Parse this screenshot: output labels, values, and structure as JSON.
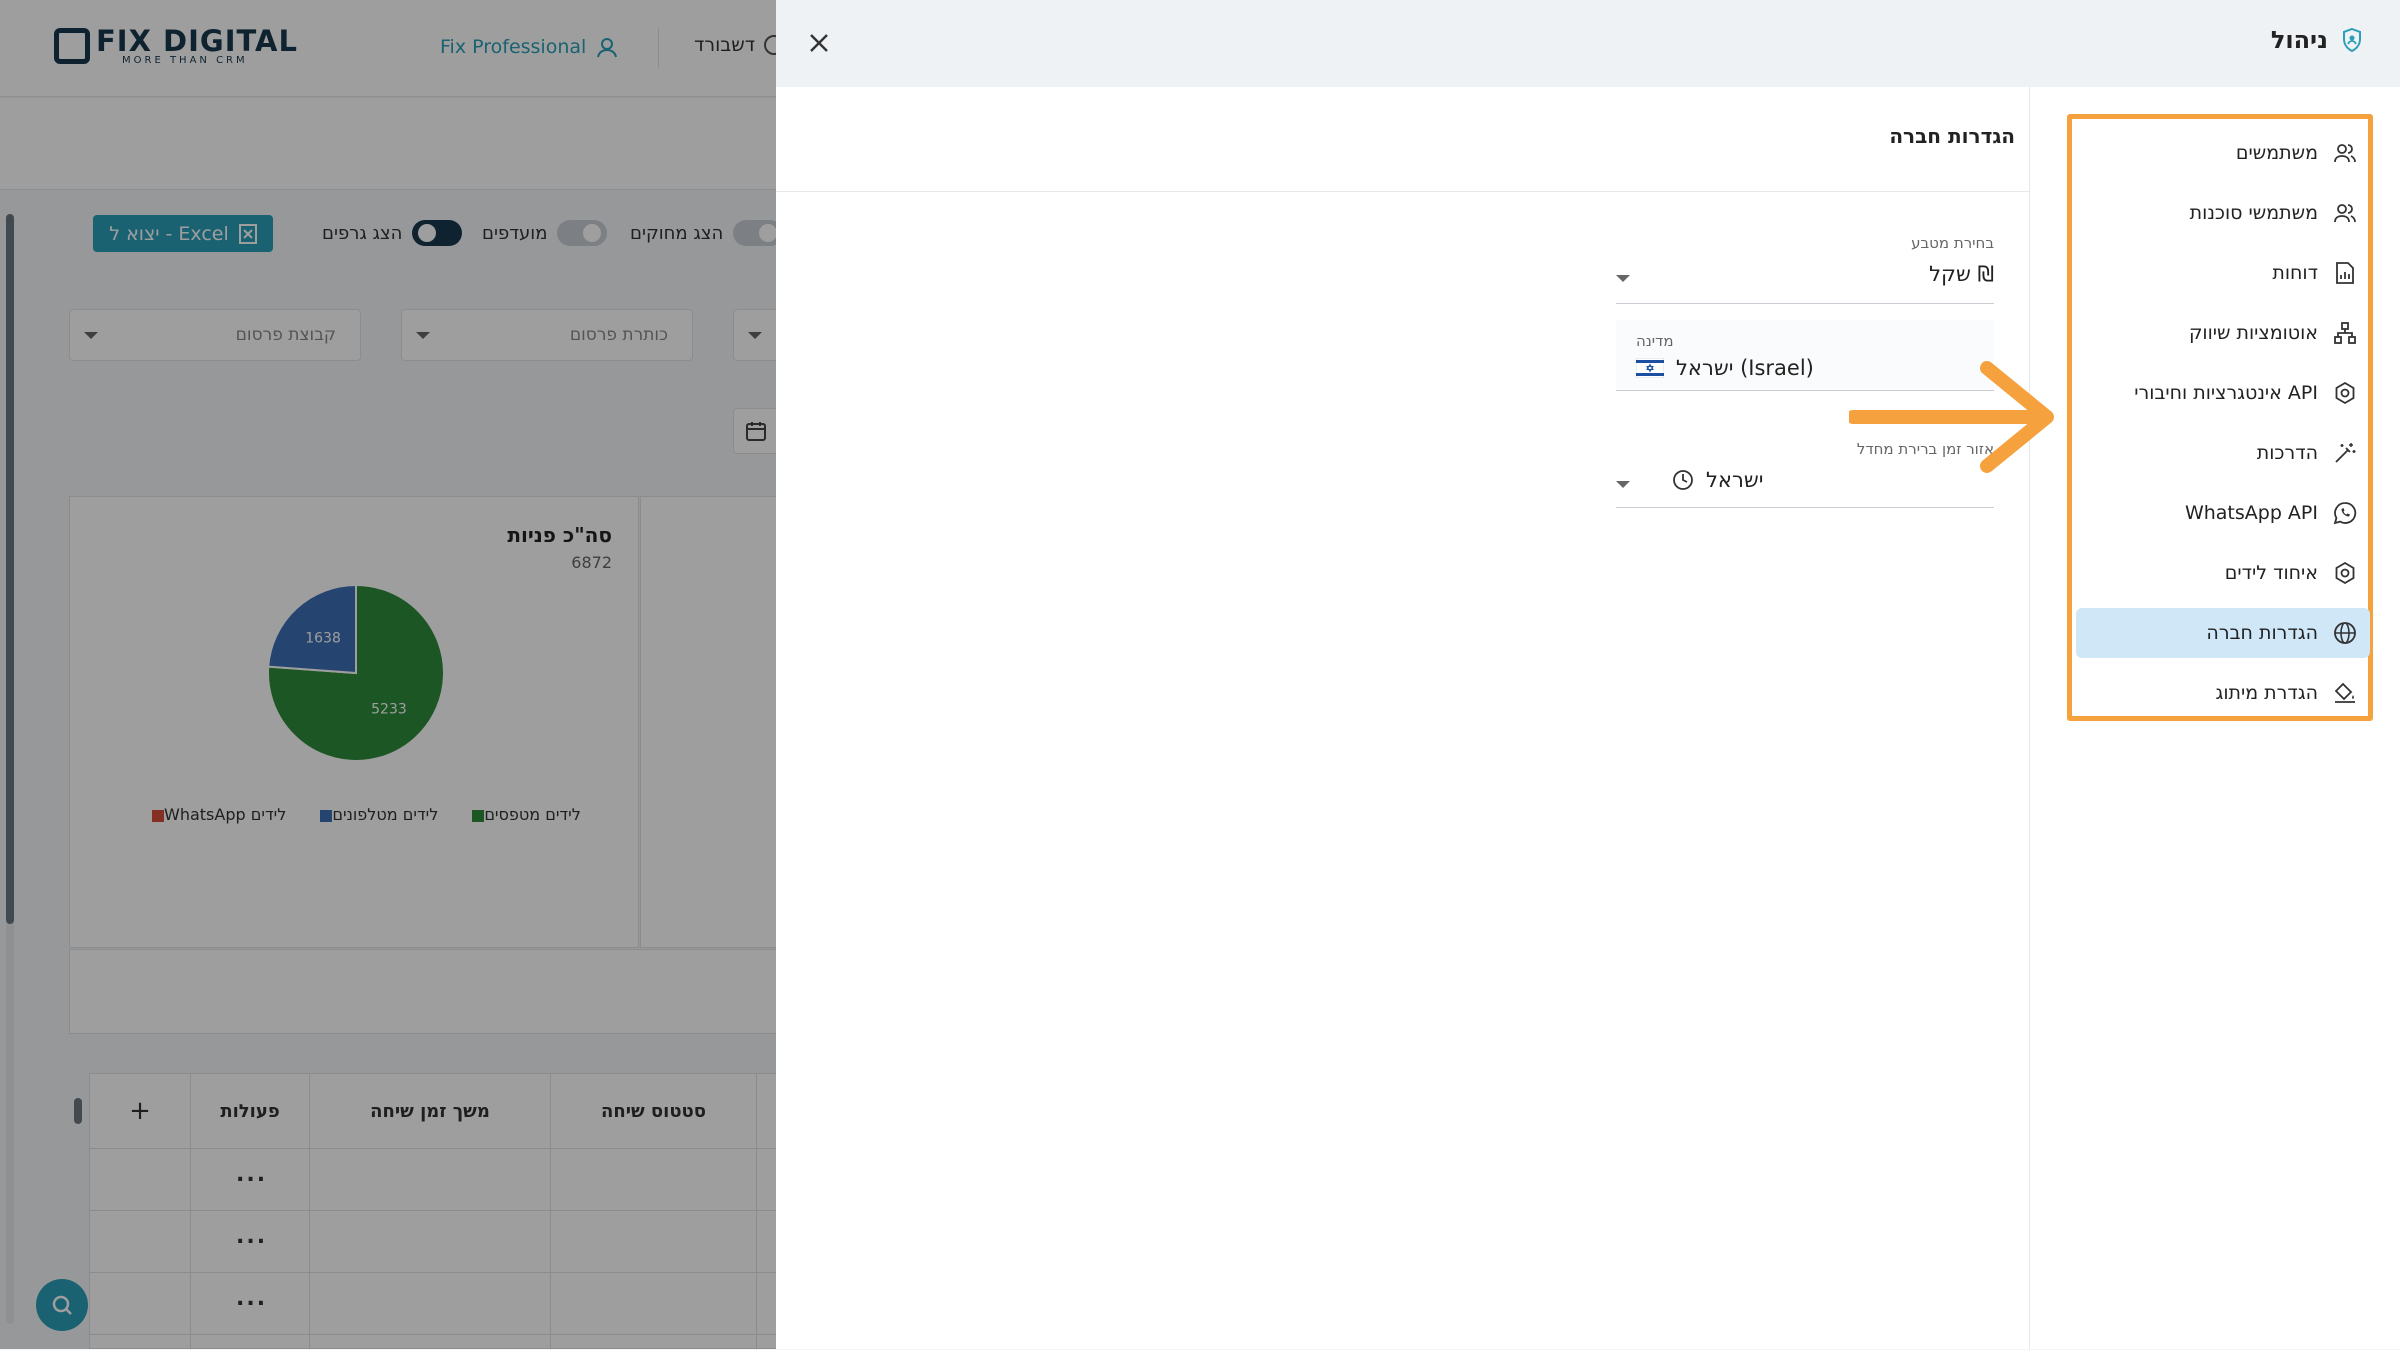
{
  "background": {
    "logo": {
      "main": "FIX DIGITAL",
      "sub": "MORE THAN CRM"
    },
    "top_links": {
      "professional": "Fix Professional",
      "dashboard": "דשבורד"
    },
    "export_button": "יצוא ל - Excel",
    "toggles": [
      {
        "label": "הצג גרפים",
        "on": true
      },
      {
        "label": "מועדפים",
        "on": false
      },
      {
        "label": "הצג מחוקים",
        "on": false
      }
    ],
    "filters": {
      "campaign_group": "קבוצת פרסום",
      "campaign_title": "כותרת פרסום"
    },
    "card": {
      "title": "סה\"כ פניות",
      "total": "6872",
      "legend": [
        "לידים מטפסים",
        "לידים מטלפונים",
        "WhatsApp לידים"
      ],
      "legend_colors": [
        "#2e8b3a",
        "#3c6fb4",
        "#d64b3a"
      ]
    },
    "table": {
      "headers": {
        "status": "סטטוס שיחה",
        "duration": "משך זמן שיחה",
        "actions": "פעולות",
        "add": "+"
      },
      "row_action": "..."
    }
  },
  "chart_data": {
    "type": "pie",
    "title": "סה\"כ פניות",
    "total": 6872,
    "categories": [
      "לידים מטפסים",
      "לידים מטלפונים",
      "WhatsApp לידים"
    ],
    "values": [
      5233,
      1638,
      0
    ],
    "labels": [
      "5233",
      "1638",
      ""
    ],
    "colors": [
      "#2e8b3a",
      "#3c6fb4",
      "#d64b3a"
    ]
  },
  "drawer": {
    "title": "ניהול",
    "close_label": "×",
    "nav_items": [
      {
        "label": "משתמשים",
        "icon": "users-icon",
        "active": false
      },
      {
        "label": "משתמשי סוכנות",
        "icon": "agency-users-icon",
        "active": false
      },
      {
        "label": "דוחות",
        "icon": "reports-icon",
        "active": false
      },
      {
        "label": "אוטומציות שיווק",
        "icon": "automation-icon",
        "active": false
      },
      {
        "label": "אינטגרציות וחיבורי API",
        "icon": "integration-gear-icon",
        "active": false
      },
      {
        "label": "הדרכות",
        "icon": "magic-wand-icon",
        "active": false
      },
      {
        "label": "WhatsApp API",
        "icon": "whatsapp-icon",
        "active": false
      },
      {
        "label": "איחוד לידים",
        "icon": "merge-gear-icon",
        "active": false
      },
      {
        "label": "הגדרות חברה",
        "icon": "globe-icon",
        "active": true
      },
      {
        "label": "הגדרת מיתוג",
        "icon": "paint-bucket-icon",
        "active": false
      }
    ],
    "section_title": "הגדרות חברה",
    "currency": {
      "label": "בחירת מטבע",
      "value": "שקל ₪"
    },
    "country": {
      "label": "מדינה",
      "value": "ישראל (Israel)"
    },
    "timezone": {
      "label": "אזור זמן ברירת מחדל",
      "value": "ישראל"
    }
  },
  "colors": {
    "accent": "#2a9fb8",
    "brand_dark": "#17384e",
    "highlight_box": "#f5a13d",
    "active_nav": "#cfe7f6"
  }
}
